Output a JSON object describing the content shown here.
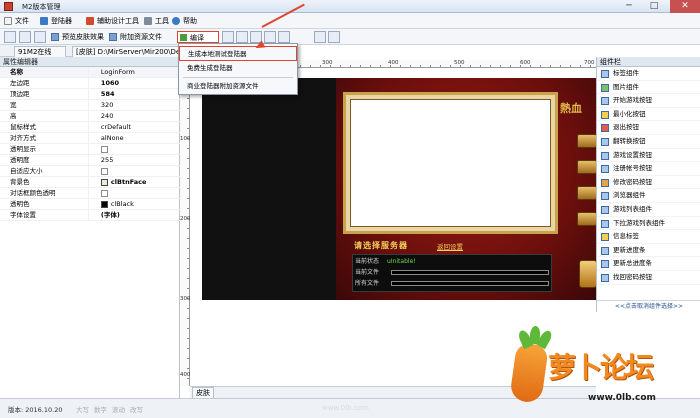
{
  "window": {
    "title": "M2版本管理",
    "controls": [
      "─",
      "□",
      "✕"
    ]
  },
  "menubar": {
    "items": [
      {
        "label": "文件",
        "icon": "file-icon"
      },
      {
        "label": "登陆器",
        "icon": "login-icon"
      },
      {
        "label": "辅助设计工具",
        "icon": "design-tool-icon"
      },
      {
        "label": "工具",
        "icon": "tools-icon"
      },
      {
        "label": "帮助",
        "icon": "help-icon"
      }
    ]
  },
  "toolbar": {
    "preview_skin": "预览皮肤效果",
    "attach_resource": "附加资源文件",
    "compile": "编译"
  },
  "tabs": {
    "tab1": "91M2在线",
    "tab2": "[皮肤] D:\\MirServer\\Mir200\\De"
  },
  "dropdown": {
    "item1": "生成本地测试登陆器",
    "item2": "免费生成登陆器",
    "item3": "商业登陆器附加资源文件"
  },
  "property_panel": {
    "title": "属性编辑器",
    "rows": [
      {
        "name": "名称",
        "value": "LoginForm",
        "header": true
      },
      {
        "name": "左边距",
        "value": "1060",
        "bold": true
      },
      {
        "name": "顶边距",
        "value": "584",
        "bold": true
      },
      {
        "name": "宽",
        "value": "320"
      },
      {
        "name": "高",
        "value": "240"
      },
      {
        "name": "鼠标样式",
        "value": "crDefault"
      },
      {
        "name": "对齐方式",
        "value": "alNone"
      },
      {
        "name": "透明显示",
        "value": ""
      },
      {
        "name": "透明度",
        "value": "255"
      },
      {
        "name": "自适应大小",
        "value": ""
      },
      {
        "name": "背景色",
        "value": "clBtnFace",
        "bold": true
      },
      {
        "name": "对话框颜色透明",
        "value": ""
      },
      {
        "name": "透明色",
        "value": "clBlack"
      },
      {
        "name": "字体设置",
        "value": "(字体)",
        "bold": true
      }
    ]
  },
  "rulers": {
    "top": [
      "100",
      "200",
      "300",
      "400",
      "500",
      "600",
      "700"
    ],
    "left": [
      "100",
      "200",
      "300",
      "400"
    ]
  },
  "canvas": {
    "select_server": "请选择服务器",
    "server_link": "返回设置",
    "status_label": "当前状态",
    "status_value": "uInitable!",
    "current_file_label": "当前文件",
    "all_files_label": "所有文件",
    "logo_text": "熱血"
  },
  "bottom_tab": "皮肤",
  "component_panel": {
    "title": "组件栏",
    "items": [
      "标签组件",
      "图片组件",
      "开始游戏按钮",
      "最小化按钮",
      "退出按钮",
      "翻转换按钮",
      "游戏设置按钮",
      "注册帐号按钮",
      "修改密码按钮",
      "浏览器组件",
      "游戏列表组件",
      "下拉游戏列表组件",
      "信息标签",
      "更新进度条",
      "更新总进度条",
      "找回密码按钮"
    ],
    "footer": "<<点击取消组件选择>>"
  },
  "statusbar": {
    "version": "版本: 2016.10.20",
    "cells": [
      "大写",
      "数字",
      "滚动",
      "改写"
    ]
  },
  "branding": {
    "forum_name": "萝卜论坛",
    "forum_url": "www.0lb.com",
    "watermark": "www.0lb.com"
  },
  "colors": {
    "accent_red": "#e0462f",
    "brand_orange": "#f08a1e",
    "canvas_red": "#6b0f0c",
    "gold": "#c9a34a"
  }
}
